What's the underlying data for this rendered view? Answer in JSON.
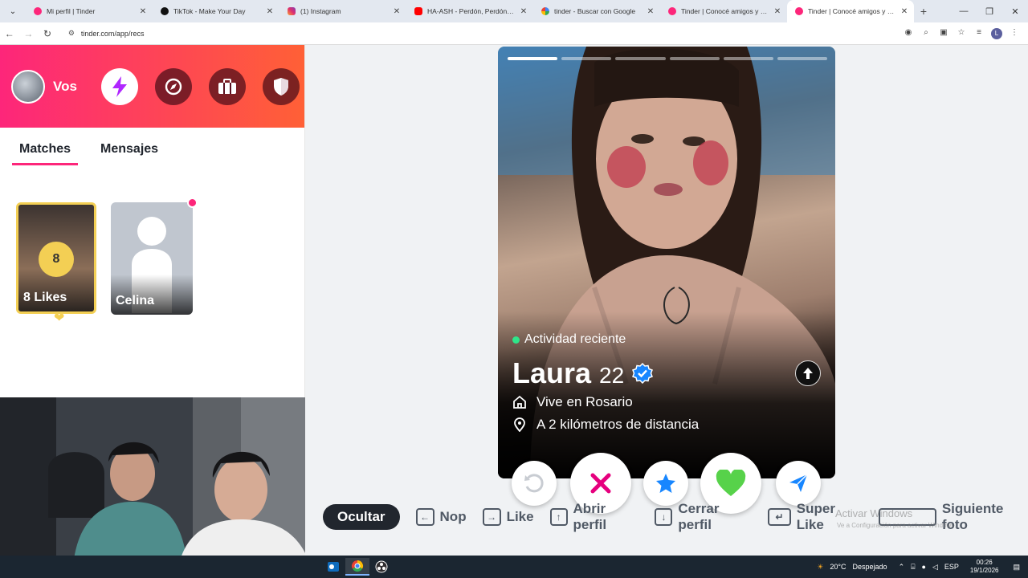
{
  "browser": {
    "tabs": [
      {
        "title": "Mi perfil | Tinder",
        "icon": "tinder-icon",
        "active": false
      },
      {
        "title": "TikTok - Make Your Day",
        "icon": "tiktok-icon",
        "active": false
      },
      {
        "title": "(1) Instagram",
        "icon": "instagram-icon",
        "active": false
      },
      {
        "title": "HA-ASH - Perdón, Perdón (Prin",
        "icon": "youtube-icon",
        "active": false
      },
      {
        "title": "tinder - Buscar con Google",
        "icon": "google-icon",
        "active": false
      },
      {
        "title": "Tinder | Conocé amigos y gent",
        "icon": "tinder-icon",
        "active": false
      },
      {
        "title": "Tinder | Conocé amigos y gent",
        "icon": "tinder-icon",
        "active": true
      }
    ],
    "new_tab": "+",
    "url": "tinder.com/app/recs",
    "profile_initial": "L"
  },
  "sidebar": {
    "user_label": "Vos",
    "tabs": [
      {
        "label": "Matches"
      },
      {
        "label": "Mensajes"
      }
    ],
    "likes_card": {
      "count": "8",
      "label": "8 Likes"
    },
    "match_card": {
      "name": "Celina"
    }
  },
  "profile": {
    "activity": "Actividad reciente",
    "name": "Laura",
    "age": "22",
    "city": "Vive en Rosario",
    "distance": "A 2 kilómetros de distancia",
    "photo_count": 6,
    "current_photo": 1
  },
  "shortcuts": {
    "hide": "Ocultar",
    "nope": "Nop",
    "like": "Like",
    "open_profile": "Abrir perfil",
    "close_profile": "Cerrar perfil",
    "super_like": "Super Like",
    "next_photo": "Siguiente foto"
  },
  "watermark": {
    "title": "Activar Windows",
    "subtitle": "Ve a Configuración para activar Windows."
  },
  "taskbar": {
    "weather": "20°C",
    "weather_text": "Despejado",
    "lang": "ESP",
    "time": "00:26",
    "date": "19/1/2026"
  },
  "colors": {
    "brand_start": "#fd267a",
    "brand_end": "#ff6036",
    "gold": "#f3cf54",
    "nope": "#e6007e",
    "like_green": "#57d24a",
    "super_blue": "#1786ff"
  }
}
